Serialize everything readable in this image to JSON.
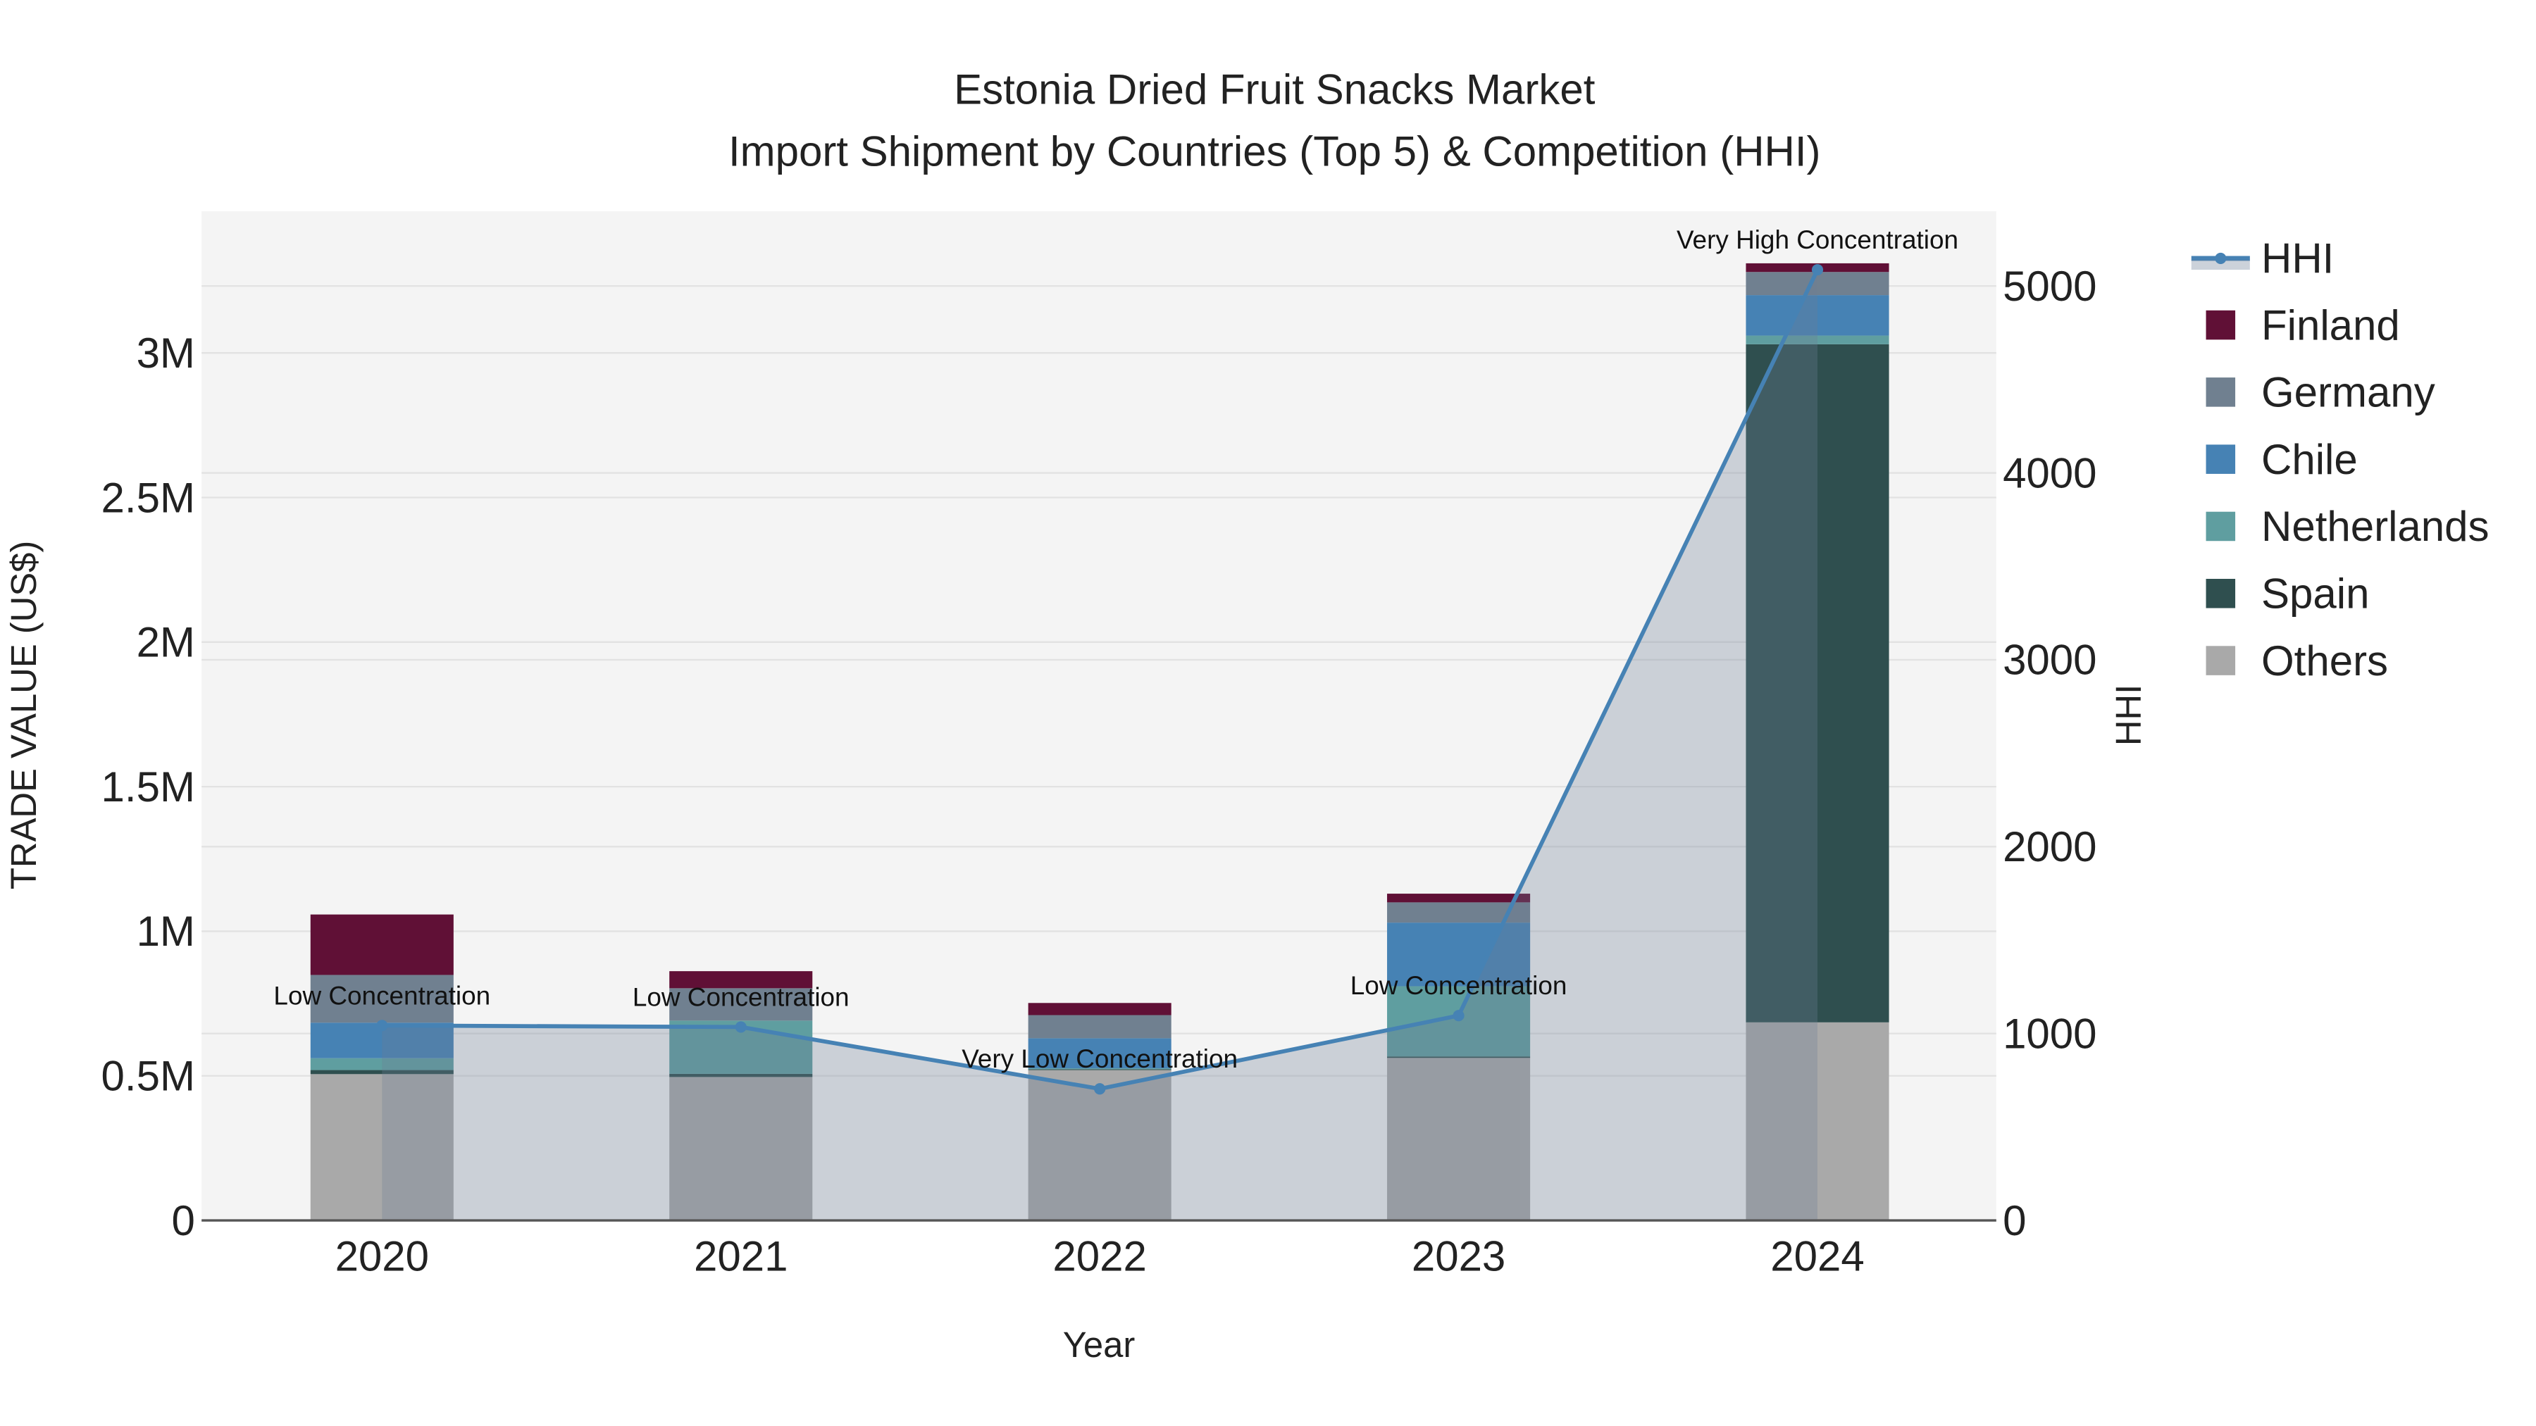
{
  "chart_data": {
    "type": "bar",
    "title": "Estonia Dried Fruit Snacks Market",
    "subtitle": "Import Shipment by Countries (Top 5) & Competition (HHI)",
    "xlabel": "Year",
    "ylabel": "TRADE VALUE (US$)",
    "y2label": "HHI",
    "categories": [
      "2020",
      "2021",
      "2022",
      "2023",
      "2024"
    ],
    "ylim": [
      0,
      3490000
    ],
    "y2lim": [
      0,
      5400
    ],
    "yticks": [
      {
        "v": 0,
        "label": "0"
      },
      {
        "v": 500000,
        "label": "0.5M"
      },
      {
        "v": 1000000,
        "label": "1M"
      },
      {
        "v": 1500000,
        "label": "1.5M"
      },
      {
        "v": 2000000,
        "label": "2M"
      },
      {
        "v": 2500000,
        "label": "2.5M"
      },
      {
        "v": 3000000,
        "label": "3M"
      }
    ],
    "y2ticks": [
      {
        "v": 0,
        "label": "0"
      },
      {
        "v": 1000,
        "label": "1000"
      },
      {
        "v": 2000,
        "label": "2000"
      },
      {
        "v": 3000,
        "label": "3000"
      },
      {
        "v": 4000,
        "label": "4000"
      },
      {
        "v": 5000,
        "label": "5000"
      }
    ],
    "series": [
      {
        "name": "Others",
        "color": "#a9a9a9",
        "values": [
          506000,
          496000,
          520000,
          562000,
          685000
        ]
      },
      {
        "name": "Spain",
        "color": "#2f4f4f",
        "values": [
          14000,
          11000,
          3000,
          5000,
          2345000
        ]
      },
      {
        "name": "Netherlands",
        "color": "#5f9ea0",
        "values": [
          41000,
          184000,
          3000,
          243000,
          30000
        ]
      },
      {
        "name": "Chile",
        "color": "#4682b4",
        "values": [
          123000,
          0,
          104000,
          220000,
          140000
        ]
      },
      {
        "name": "Germany",
        "color": "#708090",
        "values": [
          165000,
          112000,
          80000,
          70000,
          80000
        ]
      },
      {
        "name": "Finland",
        "color": "#601036",
        "values": [
          209000,
          59000,
          42000,
          30000,
          30000
        ]
      }
    ],
    "hhi": {
      "name": "HHI",
      "color": "#4682b4",
      "values": [
        1043,
        1035,
        704,
        1096,
        5087
      ],
      "labels": [
        "Low Concentration",
        "Low Concentration",
        "Very Low Concentration",
        "Low Concentration",
        "Very High Concentration"
      ]
    },
    "legend_position": "right",
    "grid": true
  }
}
